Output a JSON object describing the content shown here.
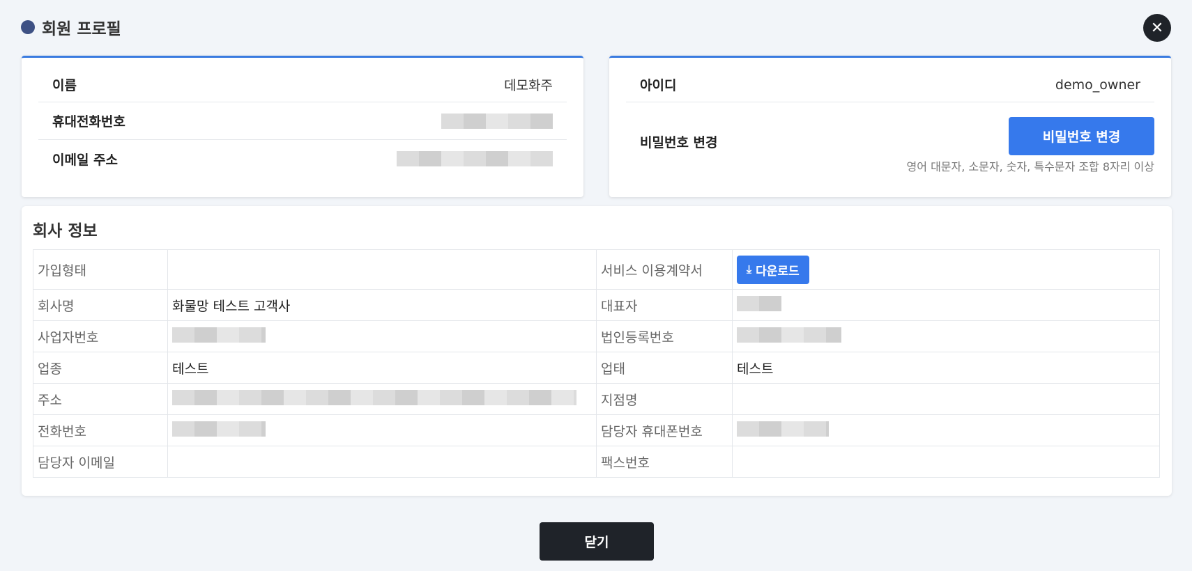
{
  "header": {
    "title": "회원 프로필",
    "close_icon": "close-icon"
  },
  "member": {
    "name_label": "이름",
    "name_value": "데모화주",
    "phone_label": "휴대전화번호",
    "email_label": "이메일 주소"
  },
  "account": {
    "id_label": "아이디",
    "id_value": "demo_owner",
    "password_label": "비밀번호 변경",
    "password_button": "비밀번호 변경",
    "password_hint": "영어 대문자, 소문자, 숫자, 특수문자 조합 8자리 이상"
  },
  "company": {
    "title": "회사 정보",
    "rows": [
      {
        "l1": "가입형태",
        "v1": "",
        "l2": "서비스 이용계약서",
        "v2": ""
      },
      {
        "l1": "회사명",
        "v1": "화물망 테스트 고객사",
        "l2": "대표자",
        "v2": ""
      },
      {
        "l1": "사업자번호",
        "v1": "",
        "l2": "법인등록번호",
        "v2": ""
      },
      {
        "l1": "업종",
        "v1": "테스트",
        "l2": "업태",
        "v2": "테스트"
      },
      {
        "l1": "주소",
        "v1": "",
        "l2": "지점명",
        "v2": ""
      },
      {
        "l1": "전화번호",
        "v1": "",
        "l2": "담당자 휴대폰번호",
        "v2": ""
      },
      {
        "l1": "담당자 이메일",
        "v1": "",
        "l2": "팩스번호",
        "v2": ""
      }
    ],
    "download_label": "다운로드",
    "download_icon": "download-icon"
  },
  "footer": {
    "close_label": "닫기"
  },
  "colors": {
    "accent": "#3679ec",
    "dark": "#1f2329",
    "title_dot": "#3e5184"
  }
}
